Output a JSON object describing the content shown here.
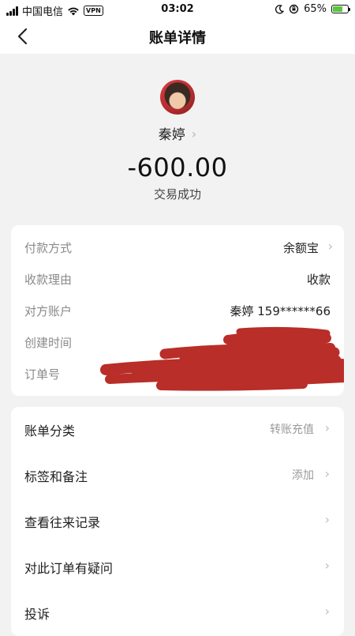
{
  "status_bar": {
    "carrier": "中国电信",
    "vpn": "VPN",
    "time": "03:02",
    "battery_text": "65%",
    "battery_level": 0.65
  },
  "nav": {
    "title": "账单详情"
  },
  "header": {
    "name": "秦婷",
    "amount": "-600.00",
    "status": "交易成功"
  },
  "details": [
    {
      "label": "付款方式",
      "value": "余额宝"
    },
    {
      "label": "收款理由",
      "value": "收款"
    },
    {
      "label": "对方账户",
      "value": "秦婷 159******66"
    },
    {
      "label": "创建时间",
      "value": ""
    },
    {
      "label": "订单号",
      "value": ""
    }
  ],
  "actions": [
    {
      "label": "账单分类",
      "value": "转账充值"
    },
    {
      "label": "标签和备注",
      "value": "添加"
    },
    {
      "label": "查看往来记录",
      "value": ""
    },
    {
      "label": "对此订单有疑问",
      "value": ""
    },
    {
      "label": "投诉",
      "value": ""
    }
  ],
  "colors": {
    "redaction": "#b41d16",
    "background": "#f3f2f2",
    "card": "#ffffff"
  }
}
